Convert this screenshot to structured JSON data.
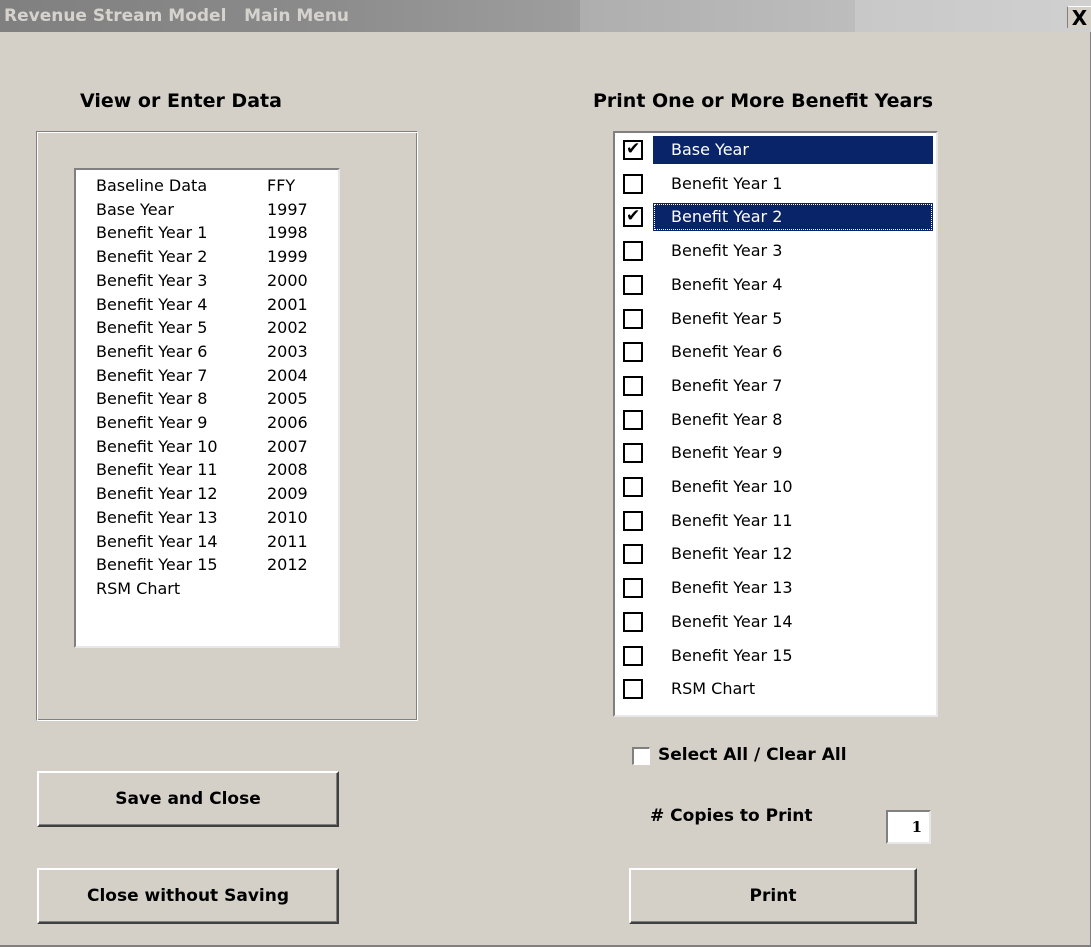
{
  "window": {
    "title": "Revenue Stream Model   Main Menu",
    "close_glyph": "X"
  },
  "view_section": {
    "heading": "View or Enter Data",
    "rows": [
      {
        "name": "Baseline Data",
        "year": "FFY"
      },
      {
        "name": "Base Year",
        "year": "1997"
      },
      {
        "name": "Benefit Year 1",
        "year": "1998"
      },
      {
        "name": "Benefit Year 2",
        "year": "1999"
      },
      {
        "name": "Benefit Year 3",
        "year": "2000"
      },
      {
        "name": "Benefit Year 4",
        "year": "2001"
      },
      {
        "name": "Benefit Year 5",
        "year": "2002"
      },
      {
        "name": "Benefit Year 6",
        "year": "2003"
      },
      {
        "name": "Benefit Year 7",
        "year": "2004"
      },
      {
        "name": "Benefit Year 8",
        "year": "2005"
      },
      {
        "name": "Benefit Year 9",
        "year": "2006"
      },
      {
        "name": "Benefit Year 10",
        "year": "2007"
      },
      {
        "name": "Benefit Year 11",
        "year": "2008"
      },
      {
        "name": "Benefit Year 12",
        "year": "2009"
      },
      {
        "name": "Benefit Year 13",
        "year": "2010"
      },
      {
        "name": "Benefit Year 14",
        "year": "2011"
      },
      {
        "name": "Benefit Year 15",
        "year": "2012"
      },
      {
        "name": "RSM Chart",
        "year": ""
      }
    ]
  },
  "print_section": {
    "heading": "Print One or More Benefit Years",
    "items": [
      {
        "label": "Base Year",
        "checked": true,
        "selected": true
      },
      {
        "label": "Benefit Year 1",
        "checked": false,
        "selected": false
      },
      {
        "label": "Benefit Year 2",
        "checked": true,
        "selected": true,
        "focused": true
      },
      {
        "label": "Benefit Year 3",
        "checked": false,
        "selected": false
      },
      {
        "label": "Benefit Year 4",
        "checked": false,
        "selected": false
      },
      {
        "label": "Benefit Year 5",
        "checked": false,
        "selected": false
      },
      {
        "label": "Benefit Year 6",
        "checked": false,
        "selected": false
      },
      {
        "label": "Benefit Year 7",
        "checked": false,
        "selected": false
      },
      {
        "label": "Benefit Year 8",
        "checked": false,
        "selected": false
      },
      {
        "label": "Benefit Year 9",
        "checked": false,
        "selected": false
      },
      {
        "label": "Benefit Year 10",
        "checked": false,
        "selected": false
      },
      {
        "label": "Benefit Year 11",
        "checked": false,
        "selected": false
      },
      {
        "label": "Benefit Year 12",
        "checked": false,
        "selected": false
      },
      {
        "label": "Benefit Year 13",
        "checked": false,
        "selected": false
      },
      {
        "label": "Benefit Year 14",
        "checked": false,
        "selected": false
      },
      {
        "label": "Benefit Year 15",
        "checked": false,
        "selected": false
      },
      {
        "label": "RSM Chart",
        "checked": false,
        "selected": false
      }
    ],
    "select_all_label": "Select All / Clear All",
    "select_all_checked": false,
    "copies_label": "# Copies to Print",
    "copies_value": "1"
  },
  "buttons": {
    "save": "Save and Close",
    "close": "Close without Saving",
    "print": "Print"
  },
  "colors": {
    "face": "#d4d0c8",
    "selection": "#0a246a"
  }
}
